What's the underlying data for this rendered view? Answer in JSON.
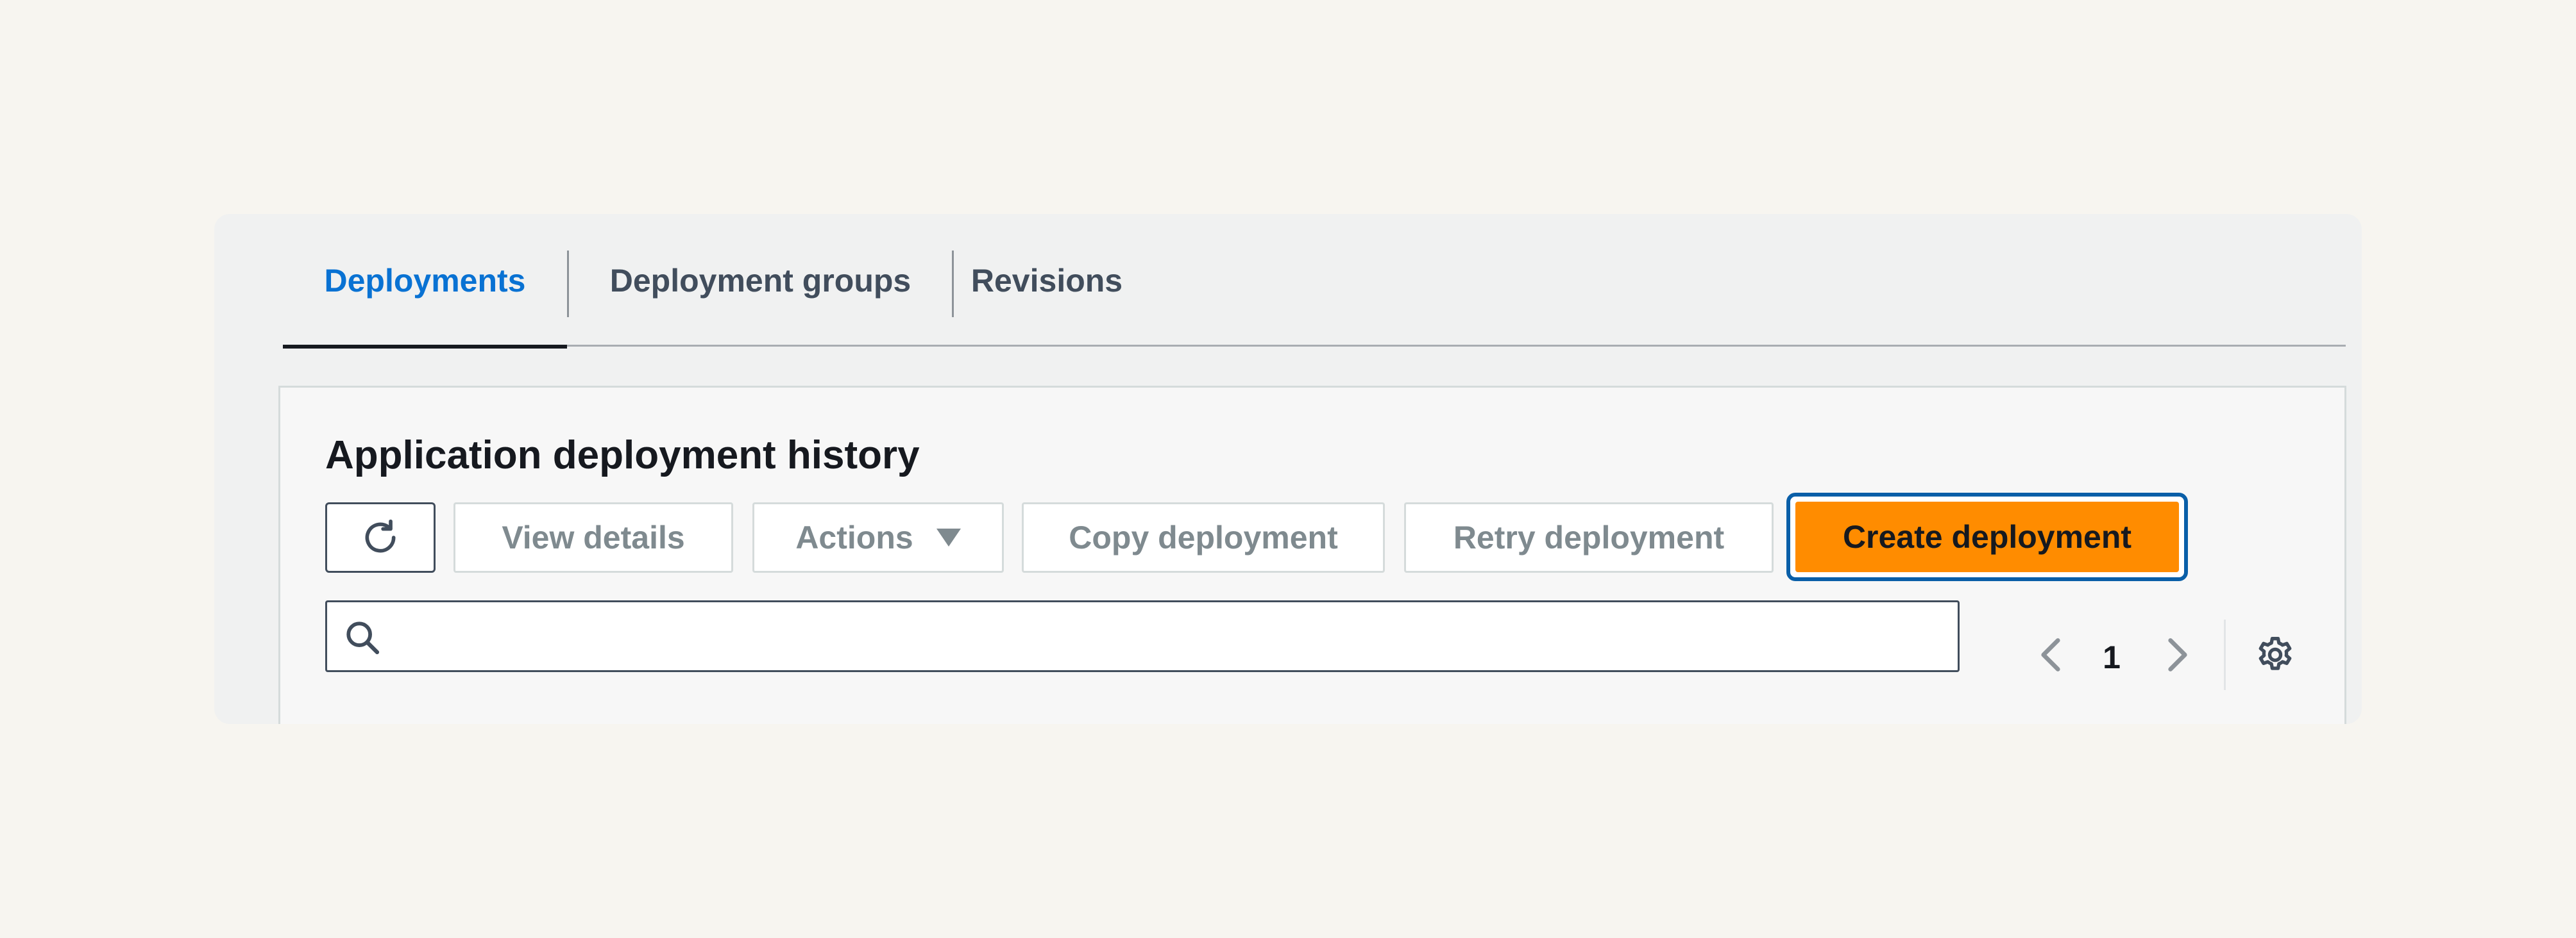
{
  "tabs": [
    {
      "label": "Deployments",
      "active": true
    },
    {
      "label": "Deployment groups",
      "active": false
    },
    {
      "label": "Revisions",
      "active": false
    }
  ],
  "panel": {
    "title": "Application deployment history"
  },
  "toolbar": {
    "refresh_icon": "refresh-icon",
    "view_details_label": "View details",
    "actions_label": "Actions",
    "copy_label": "Copy deployment",
    "retry_label": "Retry deployment",
    "create_label": "Create deployment"
  },
  "search": {
    "value": "",
    "placeholder": "",
    "icon": "search-icon"
  },
  "pagination": {
    "current_page": "1"
  },
  "colors": {
    "accent": "#0972d3",
    "primary_button": "#ff8c00",
    "focus_ring": "#0a5fa8",
    "text_dark": "#16191f",
    "text_disabled": "#7f8a8f"
  }
}
